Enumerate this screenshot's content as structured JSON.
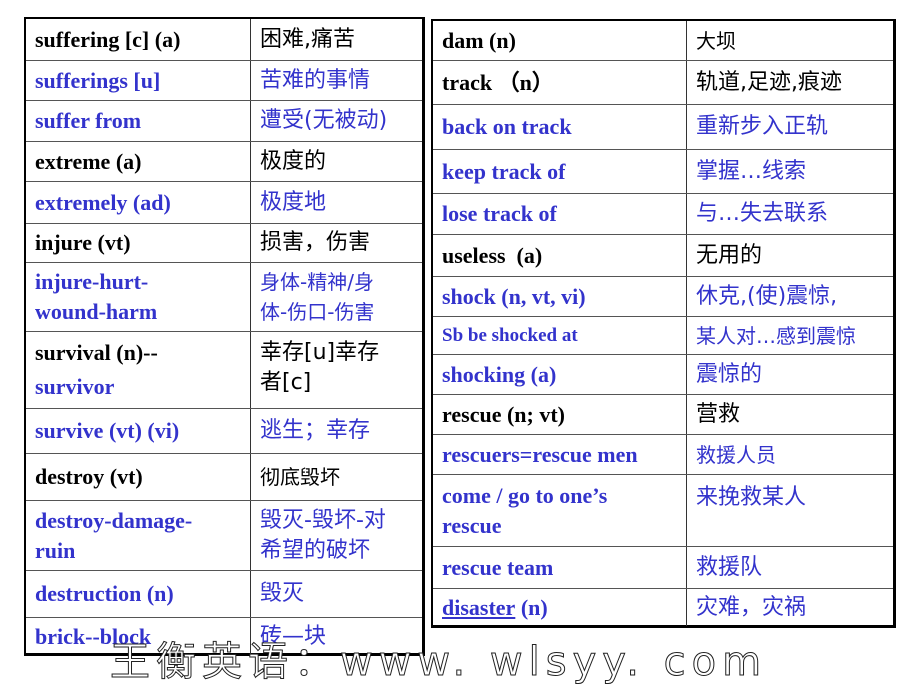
{
  "colors": {
    "primary_text": "#000000",
    "accent_blue": "#3333CC",
    "border": "#000000"
  },
  "left_table": {
    "rows": [
      {
        "en": "suffering [c] (a)",
        "cn": "困难,痛苦",
        "color": "black"
      },
      {
        "en": "sufferings [u]",
        "cn": "苦难的事情",
        "color": "blue"
      },
      {
        "en": "suffer from",
        "cn": "遭受(无被动)",
        "color": "blue"
      },
      {
        "en": "extreme (a)",
        "cn": "极度的",
        "color": "black"
      },
      {
        "en": "extremely (ad)",
        "cn": "极度地",
        "color": "blue"
      },
      {
        "en": "injure (vt)",
        "cn": "损害，伤害",
        "color": "black"
      },
      {
        "en": "injure-hurt-wound-harm",
        "en_line1": "injure-hurt-",
        "en_line2": "wound-harm",
        "cn_line1": "身体-精神/身",
        "cn_line2": "体-伤口-伤害",
        "color": "blue"
      },
      {
        "en_line1": "survival (n)--",
        "en_line2": "survivor",
        "cn_line1": "幸存[u]幸存",
        "cn_line2": "者[c]",
        "color": "black",
        "en_line2_color": "blue"
      },
      {
        "en": "survive (vt) (vi)",
        "cn": "逃生；幸存",
        "color": "blue"
      },
      {
        "en": "destroy (vt)",
        "cn": "彻底毁坏",
        "color": "black"
      },
      {
        "en_line1": "destroy-damage-",
        "en_line2": "ruin",
        "cn_line1": "毁灭-毁坏-对",
        "cn_line2": "希望的破坏",
        "color": "blue"
      },
      {
        "en": "destruction (n)",
        "cn": "毁灭",
        "color": "blue"
      },
      {
        "en": "brick--block",
        "cn": "砖—块",
        "color": "blue"
      }
    ]
  },
  "right_table": {
    "rows": [
      {
        "en": "dam (n)",
        "cn": "大坝",
        "color": "black"
      },
      {
        "en": "track （n）",
        "cn": "轨道,足迹,痕迹",
        "color": "black"
      },
      {
        "en": "back on track",
        "cn": "重新步入正轨",
        "color": "blue"
      },
      {
        "en": "keep track of",
        "cn": "掌握…线索",
        "color": "blue"
      },
      {
        "en": "lose track of",
        "cn": "与…失去联系",
        "color": "blue"
      },
      {
        "en": "useless  (a)",
        "cn": "无用的",
        "color": "black"
      },
      {
        "en": "shock (n, vt, vi)",
        "cn": "休克,(使)震惊,",
        "color": "blue"
      },
      {
        "en": "Sb be shocked at",
        "cn": "某人对…感到震惊",
        "color": "blue"
      },
      {
        "en": "shocking (a)",
        "cn": "震惊的",
        "color": "blue"
      },
      {
        "en": "rescue (n; vt)",
        "cn": "营救",
        "color": "black"
      },
      {
        "en": "rescuers=rescue men",
        "cn": "救援人员",
        "color": "blue"
      },
      {
        "en_line1": "come / go to one’s",
        "en_line2": "rescue",
        "cn": "来挽救某人",
        "color": "blue"
      },
      {
        "en": "rescue team",
        "cn": "救援队",
        "color": "blue"
      },
      {
        "en_underlined": "disaster",
        "en_rest": " (n)",
        "cn": "灾难，灾祸",
        "color": "blue"
      }
    ]
  },
  "watermark": {
    "text": "王衡英语：www. wlsyy. com"
  }
}
